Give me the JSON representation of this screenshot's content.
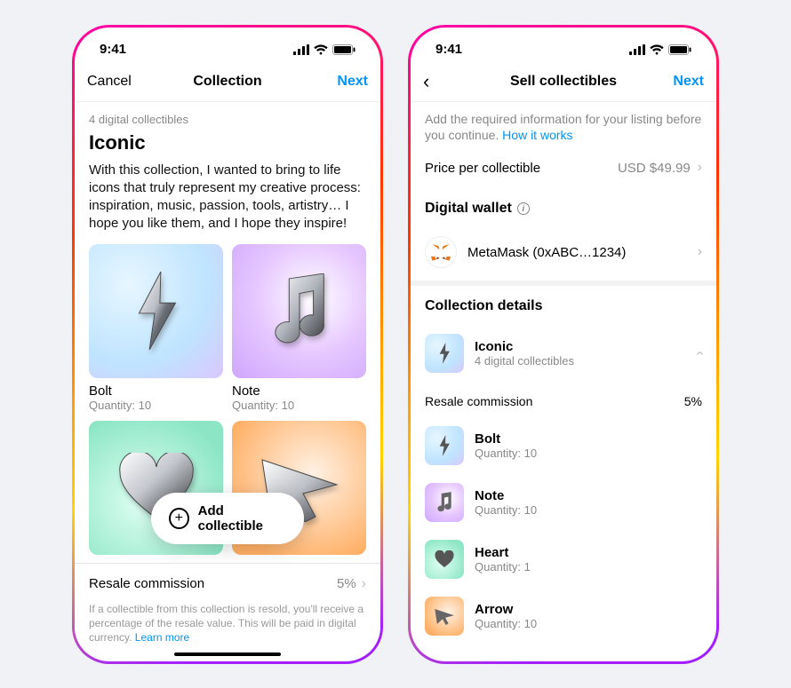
{
  "status": {
    "time": "9:41"
  },
  "left": {
    "nav": {
      "cancel": "Cancel",
      "title": "Collection",
      "next": "Next"
    },
    "count_label": "4 digital collectibles",
    "title": "Iconic",
    "description": "With this collection, I wanted to bring to life icons that truly represent my creative process: inspiration, music, passion, tools, artistry… I hope you like them, and I hope they inspire!",
    "tiles": [
      {
        "name": "Bolt",
        "qty": "Quantity: 10"
      },
      {
        "name": "Note",
        "qty": "Quantity: 10"
      }
    ],
    "add_label": "Add collectible",
    "resale": {
      "label": "Resale commission",
      "value": "5%"
    },
    "footnote": "If a collectible from this collection is resold, you'll receive a percentage of the resale value. This will be paid in digital currency. ",
    "footnote_link": "Learn more"
  },
  "right": {
    "nav": {
      "title": "Sell collectibles",
      "next": "Next"
    },
    "intro": "Add the required information for your listing before you continue. ",
    "intro_link": "How it works",
    "price": {
      "label": "Price per collectible",
      "value": "USD $49.99"
    },
    "wallet_header": "Digital wallet",
    "wallet": {
      "name": "MetaMask (0xABC…1234)"
    },
    "details_header": "Collection details",
    "collection": {
      "name": "Iconic",
      "sub": "4 digital collectibles"
    },
    "resale": {
      "label": "Resale commission",
      "value": "5%"
    },
    "items": [
      {
        "name": "Bolt",
        "qty": "Quantity: 10",
        "bg": "blue"
      },
      {
        "name": "Note",
        "qty": "Quantity: 10",
        "bg": "purple"
      },
      {
        "name": "Heart",
        "qty": "Quantity: 1",
        "bg": "green"
      },
      {
        "name": "Arrow",
        "qty": "Quantity: 10",
        "bg": "orange"
      }
    ]
  }
}
